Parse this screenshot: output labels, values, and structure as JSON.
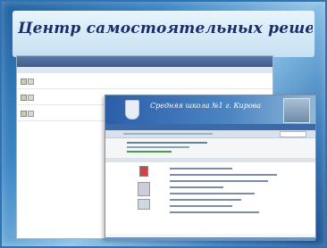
{
  "slide": {
    "title": "Центр самостоятельных решений"
  },
  "back_window": {
    "header_text": "",
    "rows": [
      {
        "name": "",
        "size": "",
        "date": ""
      },
      {
        "name": "",
        "size": "",
        "date": ""
      },
      {
        "name": "",
        "size": "",
        "date": ""
      }
    ]
  },
  "front_window": {
    "school_name": "Средняя школа №1 г. Кирова",
    "nav_items": [
      "",
      "",
      "",
      "",
      "",
      "",
      "",
      ""
    ]
  },
  "colors": {
    "background_blue": "#3c86c6",
    "title_text": "#1b2d6b",
    "banner_blue": "#2b5ea8"
  }
}
